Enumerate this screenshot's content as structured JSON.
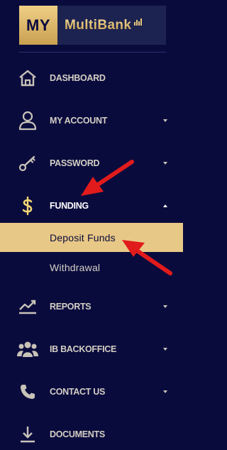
{
  "logo": {
    "prefix": "MY",
    "name": "MultiBank"
  },
  "menu": {
    "dashboard": "DASHBOARD",
    "my_account": "MY ACCOUNT",
    "password": "PASSWORD",
    "funding": "FUNDING",
    "deposit_funds": "Deposit Funds",
    "withdrawal": "Withdrawal",
    "reports": "REPORTS",
    "ib_backoffice": "IB BACKOFFICE",
    "contact_us": "CONTACT US",
    "documents": "DOCUMENTS"
  },
  "colors": {
    "background": "#0a0b3d",
    "gold": "#e8c886",
    "annotation_arrow": "#e11b1b"
  },
  "icons": [
    "home-icon",
    "user-icon",
    "key-icon",
    "dollar-icon",
    "chart-trend-icon",
    "users-group-icon",
    "phone-icon",
    "download-icon",
    "caret-down-icon",
    "caret-up-icon"
  ]
}
